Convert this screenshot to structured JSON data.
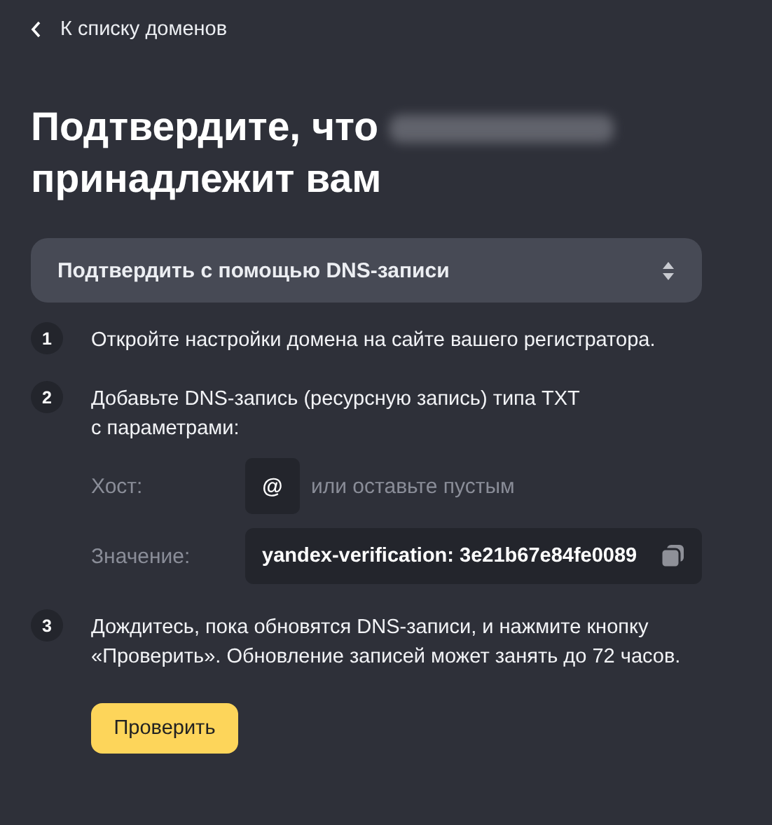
{
  "back_link": "К списку доменов",
  "title": {
    "line_1": "Подтвердите, что",
    "line_2": "принадлежит вам"
  },
  "method_select": {
    "value": "Подтвердить с помощью DNS-записи"
  },
  "steps": [
    {
      "number": "1",
      "text": "Откройте настройки домена на сайте вашего регистратора."
    },
    {
      "number": "2",
      "text": "Добавьте DNS-запись (ресурсную запись) типа TXT",
      "text_line_2": "с параметрами:",
      "params": [
        {
          "kind": "host",
          "label": "Хост:",
          "value": "@",
          "hint": "или оставьте пустым"
        },
        {
          "kind": "value",
          "label": "Значение:",
          "value": "yandex-verification: 3e21b67e84fe0089"
        }
      ]
    },
    {
      "number": "3",
      "text": "Дождитесь, пока обновятся DNS-записи, и нажмите кнопку",
      "text_line_2": "«Проверить». Обновление записей может занять до 72 часов."
    }
  ],
  "check_button": "Проверить"
}
